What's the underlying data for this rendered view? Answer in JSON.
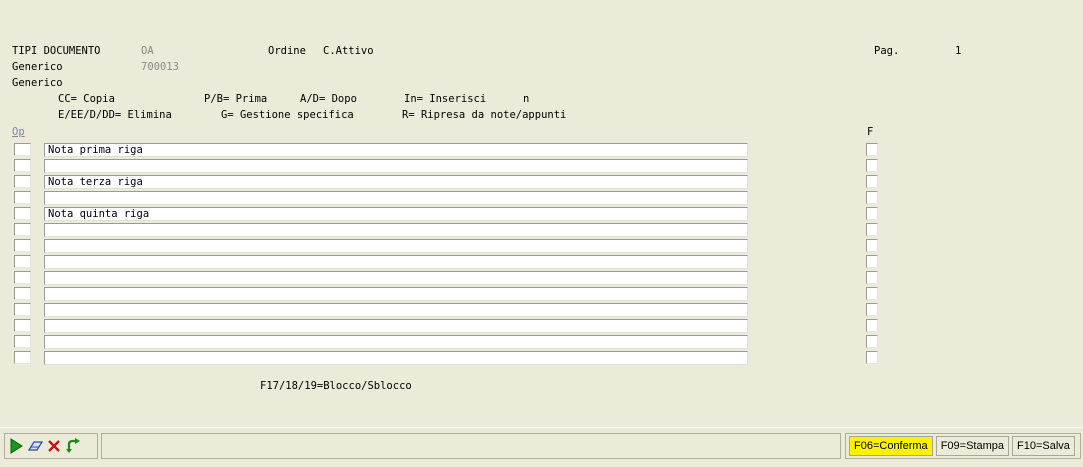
{
  "header": {
    "line1": {
      "label": "TIPI DOCUMENTO",
      "code": "OA",
      "desc_label": "Ordine",
      "desc_value": "C.Attivo",
      "page_label": "Pag.",
      "page_value": "1"
    },
    "line2": {
      "label": "Generico",
      "code": "700013"
    },
    "line3": {
      "label": "Generico"
    }
  },
  "legend": {
    "row1": {
      "cc": "CC= Copia",
      "pb": "P/B= Prima",
      "ad": "A/D= Dopo",
      "in": "In= Inserisci",
      "n": "n"
    },
    "row2": {
      "elimina": "E/EE/D/DD= Elimina",
      "gestione": "G= Gestione specifica",
      "ripresa": "R= Ripresa da note/appunti"
    }
  },
  "columns": {
    "op": "Op",
    "f": "F"
  },
  "notes": [
    "Nota prima riga",
    "",
    "Nota terza riga",
    "",
    "Nota quinta riga",
    "",
    "",
    "",
    "",
    "",
    "",
    "",
    "",
    ""
  ],
  "footer_hint": "F17/18/19=Blocco/Sblocco",
  "toolbar": {
    "icons": [
      "run-icon",
      "eraser-icon",
      "close-icon",
      "refresh-icon"
    ],
    "function_keys": [
      {
        "label": "F06=Conferma",
        "active": true
      },
      {
        "label": "F09=Stampa",
        "active": false
      },
      {
        "label": "F10=Salva",
        "active": false
      }
    ]
  }
}
